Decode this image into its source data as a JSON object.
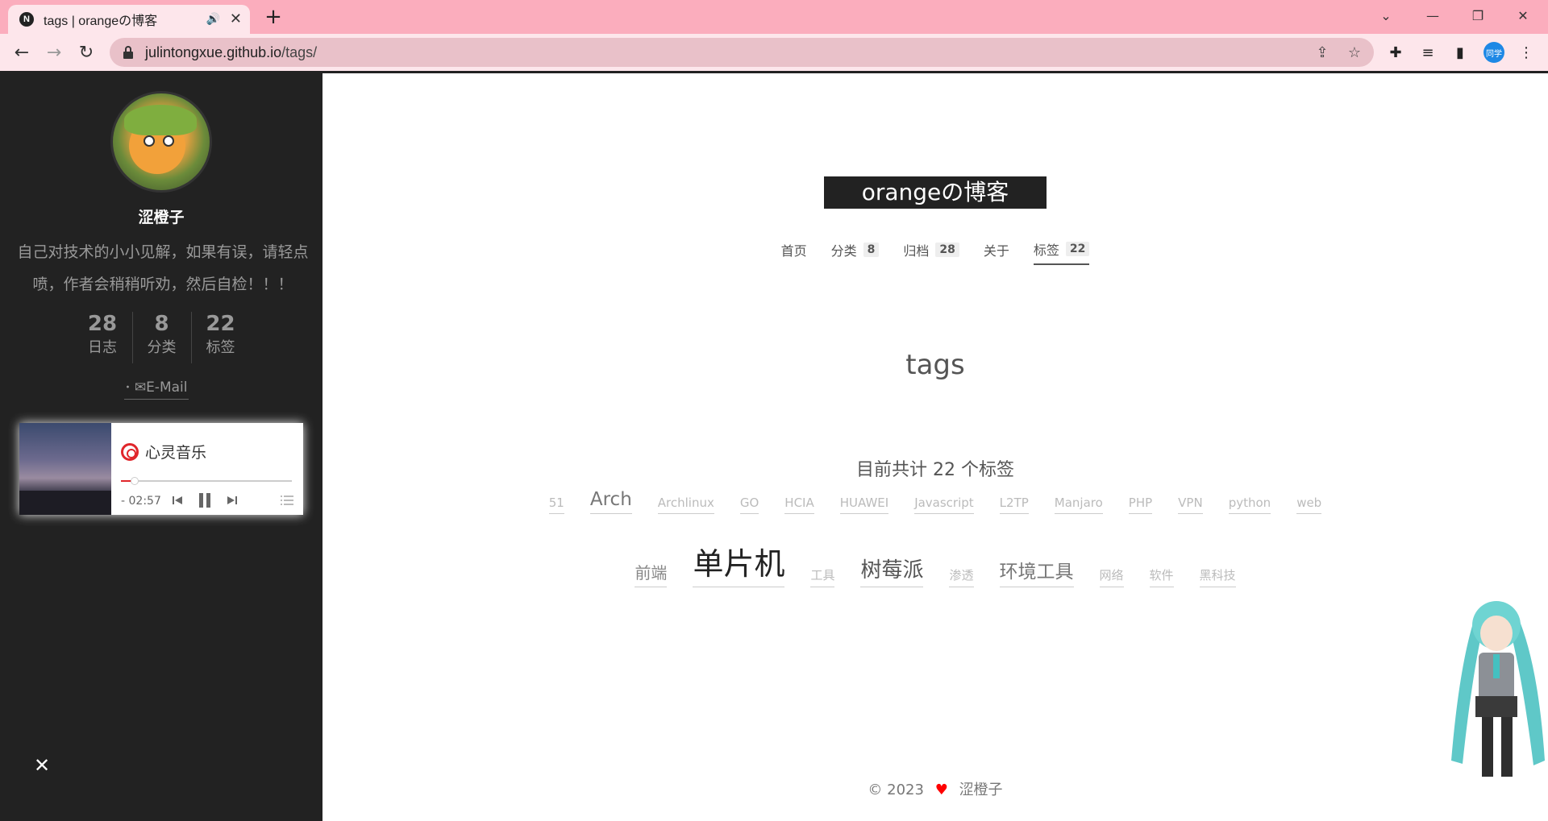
{
  "browser": {
    "tab_title": "tags | orangeの博客",
    "favicon_letter": "N",
    "url_host": "julintongxue.github.io",
    "url_path": "/tags/",
    "profile_label": "同学"
  },
  "sidebar": {
    "author_name": "涩橙子",
    "description": "自己对技术的小小见解，如果有误，请轻点喷，作者会稍稍听劝，然后自检！！！",
    "stats": [
      {
        "num": "28",
        "label": "日志"
      },
      {
        "num": "8",
        "label": "分类"
      },
      {
        "num": "22",
        "label": "标签"
      }
    ],
    "email_label": "E-Mail",
    "player": {
      "song": "心灵音乐",
      "time": "- 02:57",
      "progress": 0.08
    },
    "close_label": "✕"
  },
  "main": {
    "brand": "orangeの博客",
    "menu": [
      {
        "label": "首页",
        "badge": ""
      },
      {
        "label": "分类",
        "badge": "8"
      },
      {
        "label": "归档",
        "badge": "28"
      },
      {
        "label": "关于",
        "badge": ""
      },
      {
        "label": "标签",
        "badge": "22"
      }
    ],
    "page_title": "tags",
    "tag_count_text": "目前共计 22 个标签",
    "tags_row1": [
      {
        "name": "51",
        "size": 1
      },
      {
        "name": "Arch",
        "size": 3
      },
      {
        "name": "Archlinux",
        "size": 1
      },
      {
        "name": "GO",
        "size": 1
      },
      {
        "name": "HCIA",
        "size": 1
      },
      {
        "name": "HUAWEI",
        "size": 1
      },
      {
        "name": "Javascript",
        "size": 1
      },
      {
        "name": "L2TP",
        "size": 1
      },
      {
        "name": "Manjaro",
        "size": 1
      },
      {
        "name": "PHP",
        "size": 1
      },
      {
        "name": "VPN",
        "size": 1
      },
      {
        "name": "python",
        "size": 1
      },
      {
        "name": "web",
        "size": 1
      }
    ],
    "tags_row2": [
      {
        "name": "前端",
        "size": 2
      },
      {
        "name": "单片机",
        "size": 5
      },
      {
        "name": "工具",
        "size": 1
      },
      {
        "name": "树莓派",
        "size": 4
      },
      {
        "name": "渗透",
        "size": 1
      },
      {
        "name": "环境工具",
        "size": 3
      },
      {
        "name": "网络",
        "size": 1
      },
      {
        "name": "软件",
        "size": 1
      },
      {
        "name": "黑科技",
        "size": 1
      }
    ],
    "footer_year": "© 2023",
    "footer_author": "涩橙子"
  },
  "colors": {
    "tabbar": "#fbadbd",
    "sidebar_bg": "#222222",
    "heart": "#ff0000",
    "netease_red": "#e0262b"
  }
}
